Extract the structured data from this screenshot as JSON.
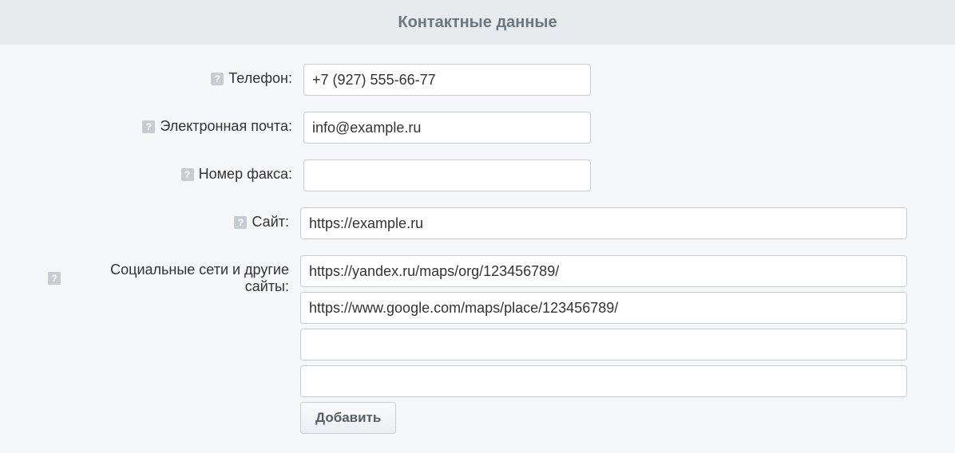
{
  "header": {
    "title": "Контактные данные"
  },
  "fields": {
    "phone": {
      "label": "Телефон:",
      "value": "+7 (927) 555-66-77"
    },
    "email": {
      "label": "Электронная почта:",
      "value": "info@example.ru"
    },
    "fax": {
      "label": "Номер факса:",
      "value": ""
    },
    "site": {
      "label": "Сайт:",
      "value": "https://example.ru"
    },
    "social": {
      "label": "Социальные сети и другие сайты:",
      "values": [
        "https://yandex.ru/maps/org/123456789/",
        "https://www.google.com/maps/place/123456789/",
        "",
        ""
      ],
      "add_button": "Добавить"
    }
  },
  "glyphs": {
    "help": "?"
  }
}
